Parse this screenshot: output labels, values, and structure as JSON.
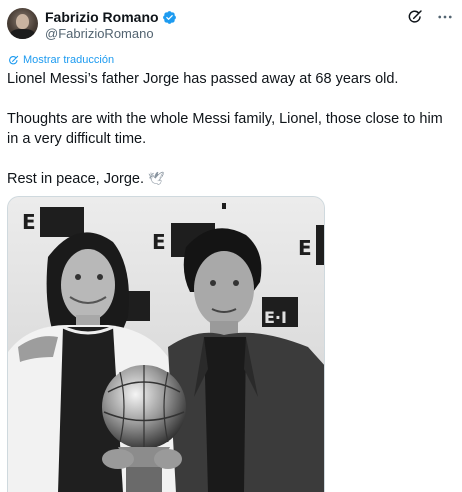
{
  "author": {
    "display_name": "Fabrizio Romano",
    "handle": "@FabrizioRomano",
    "avatar_icon": "avatar",
    "verified_color": "#1d9bf0"
  },
  "actions": {
    "grok_icon": "grok-icon",
    "more_icon": "more-icon"
  },
  "translate": {
    "label": "Mostrar traducción",
    "color": "#1d9bf0"
  },
  "tweet": {
    "line1": "Lionel Messi’s father Jorge has passed away at 68 years old.",
    "line2": "Thoughts are with the whole Messi family, Lionel, those close to him in a very difficult time.",
    "line3": "Rest in peace, Jorge.",
    "emoji": "🕊"
  },
  "media": {
    "type": "photo",
    "description_icon": "photo-messi-father"
  }
}
